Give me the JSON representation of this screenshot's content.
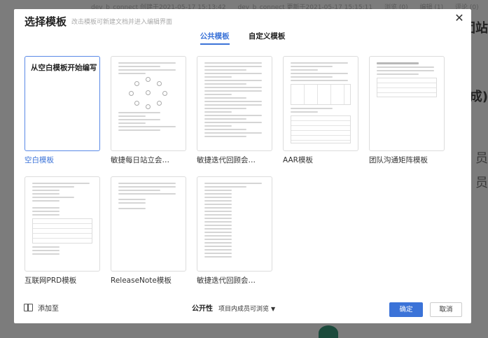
{
  "background": {
    "meta": [
      "dev_b_connect 创建于2021-05-17 15:13:42",
      "dev_b_connect 更新于2021-05-17 15:15:11",
      "浏览 (0)",
      "编辑 (1)",
      "评论 (0)"
    ],
    "right_text_1": "团站",
    "right_text_2": "成)",
    "right_text_3": "员",
    "right_text_4": "员"
  },
  "modal": {
    "title": "选择模板",
    "subtitle": "改击模板可新建文档并进入编辑界面",
    "close_icon": "close-icon",
    "tabs": [
      {
        "label": "公共模板",
        "active": true
      },
      {
        "label": "自定义模板",
        "active": false
      }
    ],
    "templates": [
      {
        "label": "空白模板",
        "thumb_title": "从空白模板开始编写",
        "selected": true
      },
      {
        "label": "敏捷每日站立会…"
      },
      {
        "label": "敏捷迭代回顾会…"
      },
      {
        "label": "AAR模板"
      },
      {
        "label": "团队沟通矩阵模板"
      },
      {
        "label": "互联网PRD模板"
      },
      {
        "label": "ReleaseNote模板"
      },
      {
        "label": "敏捷迭代回顾会…"
      }
    ],
    "footer": {
      "add_to": "添加至",
      "add_icon": "book-icon",
      "visibility_label": "公开性",
      "visibility_value": "项目内成员可浏览",
      "ok": "确定",
      "cancel": "取消"
    }
  },
  "colors": {
    "accent": "#3b73d8",
    "overlay": "#7c7c7c"
  }
}
